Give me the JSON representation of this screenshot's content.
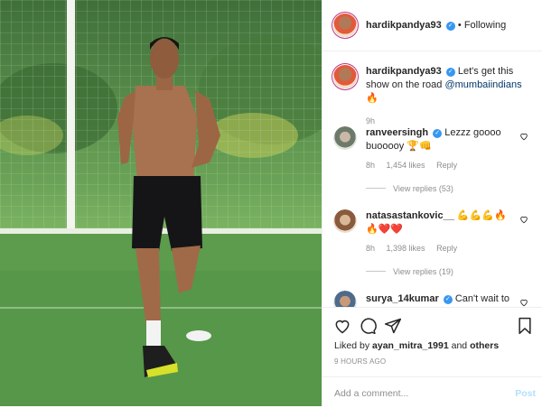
{
  "header": {
    "username": "hardikpandya93",
    "follow_label": "Following"
  },
  "caption": {
    "username": "hardikpandya93",
    "text": "Let's get this show on the road",
    "mention": "@mumbaiindians",
    "emoji": "🔥",
    "time": "9h"
  },
  "comments": [
    {
      "username": "ranveersingh",
      "verified": true,
      "text": "Lezzz goooo buooooy 🏆👊",
      "time": "8h",
      "likes": "1,454 likes",
      "reply": "Reply",
      "view_replies": "View replies (53)"
    },
    {
      "username": "natasastankovic__",
      "verified": false,
      "text": "💪💪💪🔥🔥❤️❤️",
      "time": "8h",
      "likes": "1,398 likes",
      "reply": "Reply",
      "view_replies": "View replies (19)"
    },
    {
      "username": "surya_14kumar",
      "verified": true,
      "text": "Can't wait to"
    }
  ],
  "actions": {
    "liked_prefix": "Liked by",
    "liked_user": "ayan_mitra_1991",
    "liked_and": "and",
    "liked_others": "others",
    "posted": "9 HOURS AGO"
  },
  "comment_box": {
    "placeholder": "Add a comment...",
    "post_label": "Post"
  },
  "colors": {
    "verified": "#3897f0",
    "link": "#00376b",
    "post_disabled": "#b2dffc",
    "turf": "#5f9a4e"
  },
  "icons": [
    "heart-icon",
    "comment-icon",
    "share-icon",
    "bookmark-icon",
    "verified-icon"
  ]
}
